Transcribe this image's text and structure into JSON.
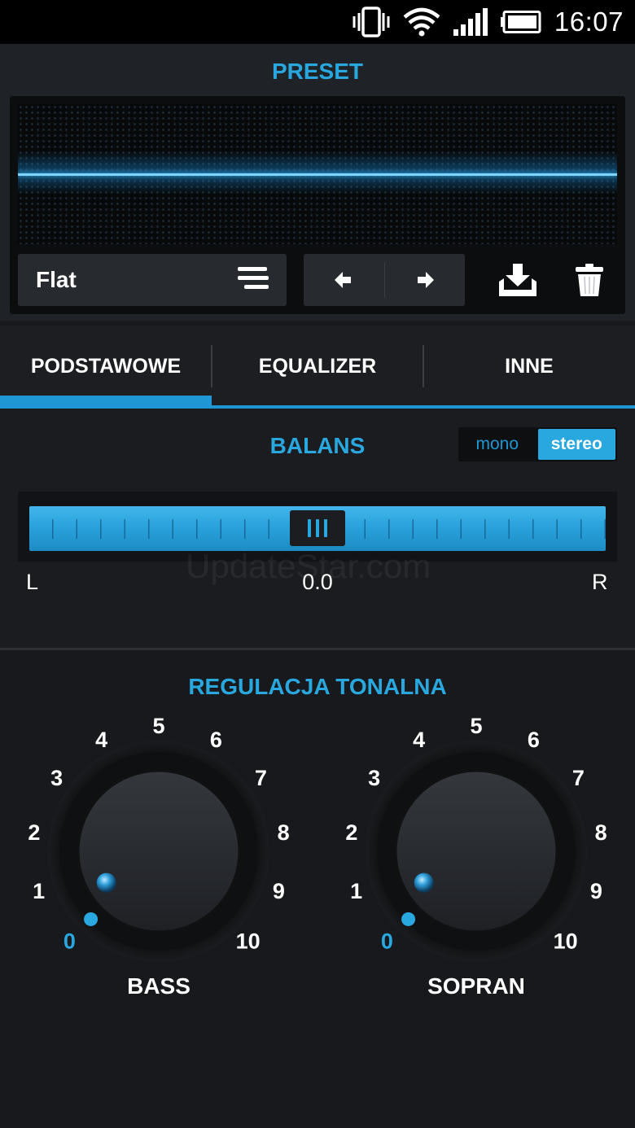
{
  "status_bar": {
    "time": "16:07",
    "icons": [
      "vibrate-icon",
      "wifi-icon",
      "signal-icon",
      "battery-icon"
    ]
  },
  "preset": {
    "title": "PRESET",
    "selected": "Flat",
    "eq_level": 0
  },
  "tabs": [
    {
      "label": "PODSTAWOWE",
      "active": true
    },
    {
      "label": "EQUALIZER",
      "active": false
    },
    {
      "label": "INNE",
      "active": false
    }
  ],
  "balance": {
    "title": "BALANS",
    "modes": {
      "mono": "mono",
      "stereo": "stereo",
      "selected": "stereo"
    },
    "value": "0.0",
    "left_label": "L",
    "right_label": "R"
  },
  "watermark": "UpdateStar.com",
  "tone": {
    "title": "REGULACJA TONALNA",
    "scale": [
      "0",
      "1",
      "2",
      "3",
      "4",
      "5",
      "6",
      "7",
      "8",
      "9",
      "10"
    ],
    "knobs": [
      {
        "id": "bass",
        "label": "BASS",
        "value": 0
      },
      {
        "id": "sopran",
        "label": "SOPRAN",
        "value": 0
      }
    ]
  },
  "colors": {
    "accent": "#29a8e0",
    "background": "#17191c",
    "panel": "#272a2e"
  }
}
